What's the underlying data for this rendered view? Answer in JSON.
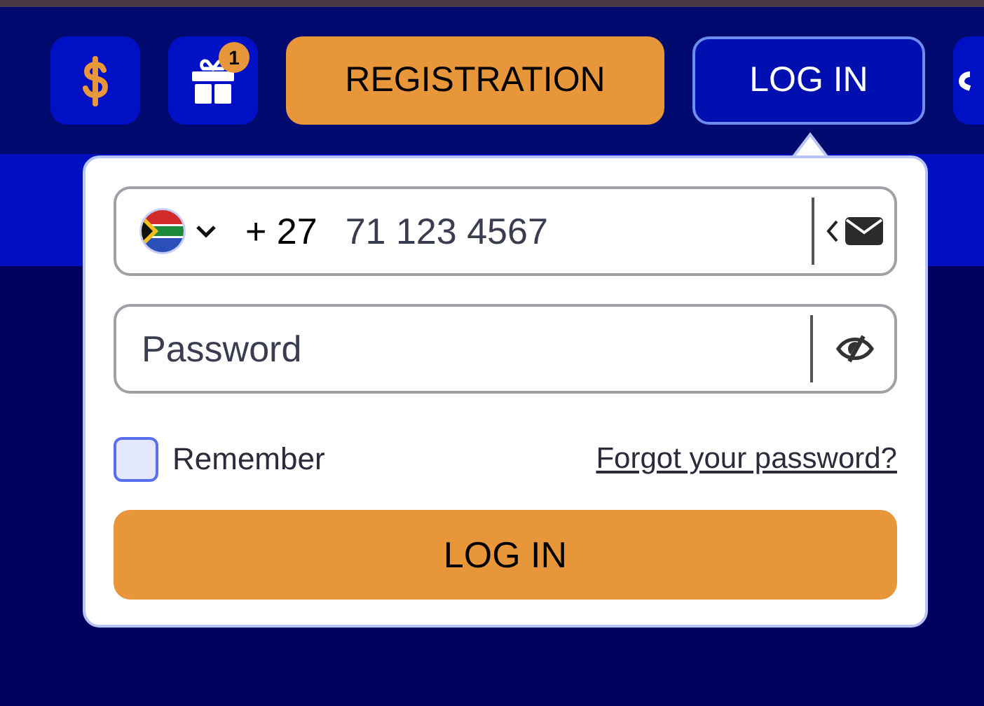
{
  "header": {
    "gift_badge": "1",
    "registration_button": "REGISTRATION",
    "login_button": "LOG IN"
  },
  "login_popup": {
    "phone": {
      "country_code": "+ 27",
      "placeholder": "71 123 4567"
    },
    "password": {
      "placeholder": "Password"
    },
    "remember": {
      "label": "Remember",
      "checked": false
    },
    "forgot_link": "Forgot your password?",
    "submit_button": "LOG IN"
  }
}
